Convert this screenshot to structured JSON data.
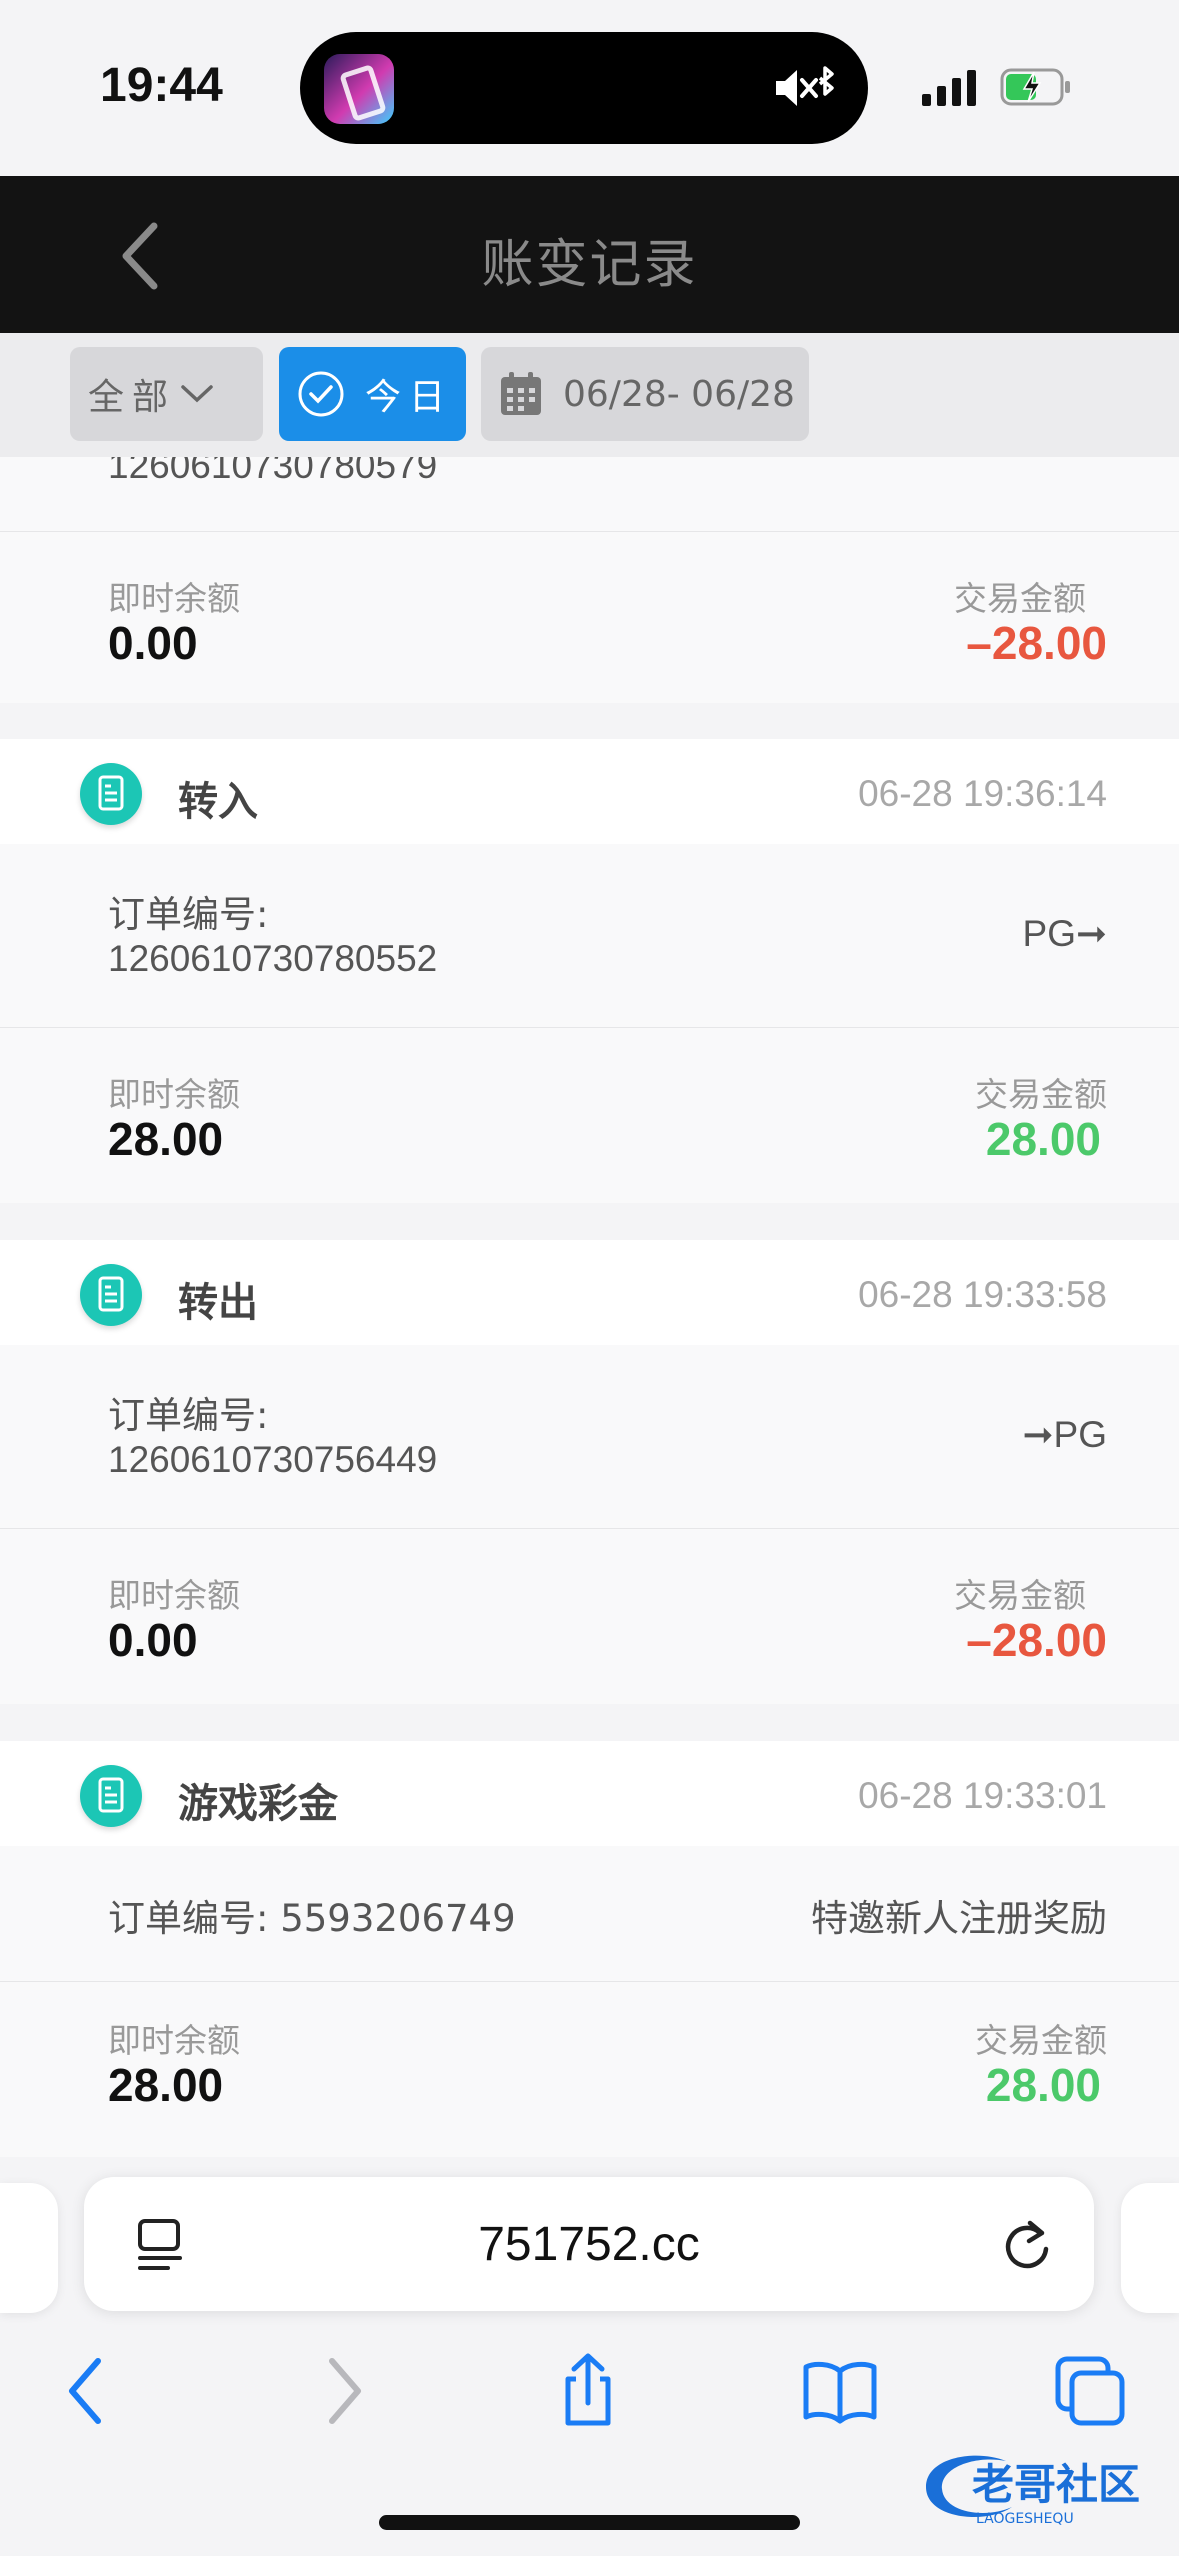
{
  "status_bar": {
    "time": "19:44",
    "battery_state": "charging"
  },
  "header": {
    "title": "账变记录"
  },
  "filters": {
    "all_label": "全部",
    "today_label": "今日",
    "date_range": "06/28- 06/28"
  },
  "colors": {
    "accent": "#1b8ee8",
    "negative": "#e8573f",
    "positive": "#4cc96a",
    "icon_bg": "#1cc6b5"
  },
  "partial_card": {
    "order_no": "1260610730780579",
    "balance_label": "即时余额",
    "balance": "0.00",
    "amount_label": "交易金额",
    "amount": "–28.00"
  },
  "cards": [
    {
      "type": "转入",
      "time": "06-28 19:36:14",
      "order_label": "订单编号:",
      "order_no": "1260610730780552",
      "target": "PG➞",
      "balance_label": "即时余额",
      "balance": "28.00",
      "amount_label": "交易金额",
      "amount": "28.00"
    },
    {
      "type": "转出",
      "time": "06-28 19:33:58",
      "order_label": "订单编号:",
      "order_no": "1260610730756449",
      "target": "➞PG",
      "balance_label": "即时余额",
      "balance": "0.00",
      "amount_label": "交易金额",
      "amount": "–28.00"
    },
    {
      "type": "游戏彩金",
      "time": "06-28 19:33:01",
      "order_label": "订单编号: 5593206749",
      "target": "特邀新人注册奖励",
      "balance_label": "即时余额",
      "balance": "28.00",
      "amount_label": "交易金额",
      "amount": "28.00"
    }
  ],
  "browser": {
    "url": "751752.cc"
  },
  "watermark": {
    "text": "老哥社区",
    "subtext": "LAOGESHEQU"
  }
}
